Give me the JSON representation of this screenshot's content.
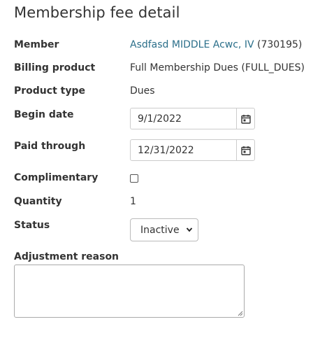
{
  "title": "Membership fee detail",
  "fields": {
    "member": {
      "label": "Member",
      "link_text": "Asdfasd MIDDLE Acwc, IV",
      "id_text": "(730195)"
    },
    "billing_product": {
      "label": "Billing product",
      "value": "Full Membership Dues (FULL_DUES)"
    },
    "product_type": {
      "label": "Product type",
      "value": "Dues"
    },
    "begin_date": {
      "label": "Begin date",
      "value": "9/1/2022",
      "icon": "calendar-icon"
    },
    "paid_through": {
      "label": "Paid through",
      "value": "12/31/2022",
      "icon": "calendar-icon"
    },
    "complimentary": {
      "label": "Complimentary",
      "checked": false
    },
    "quantity": {
      "label": "Quantity",
      "value": "1"
    },
    "status": {
      "label": "Status",
      "selected": "Inactive",
      "icon": "chevron-down-icon"
    },
    "adjustment_reason": {
      "label": "Adjustment reason",
      "value": ""
    }
  },
  "colors": {
    "link": "#2b6f8a",
    "text": "#333333",
    "border": "#cccccc"
  }
}
